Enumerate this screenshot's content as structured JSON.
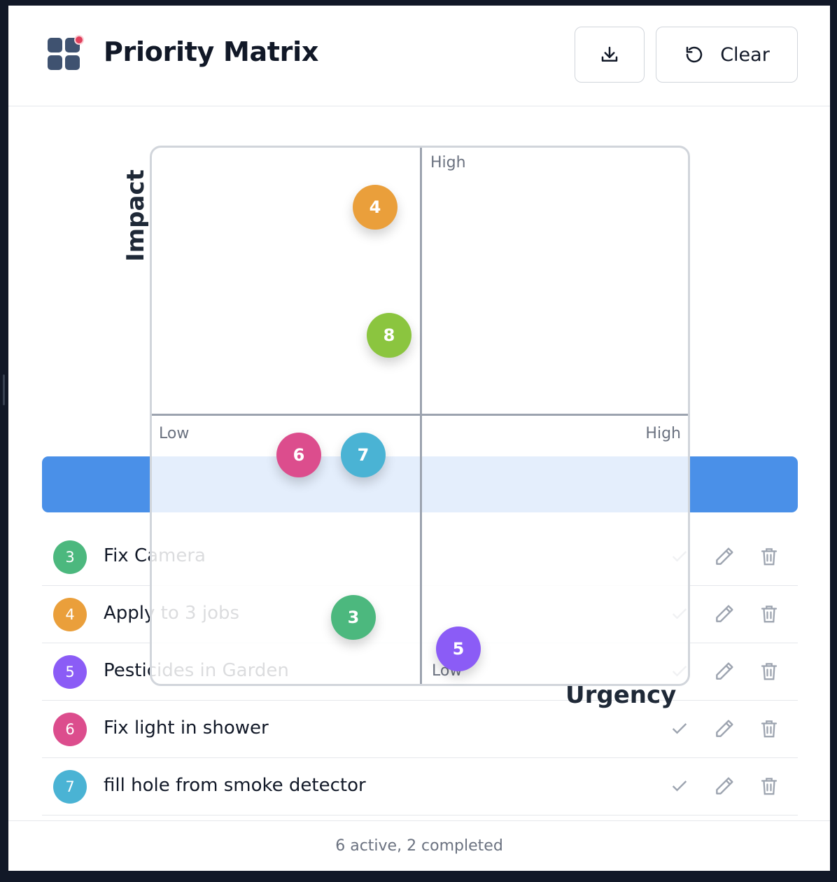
{
  "app": {
    "title": "Priority Matrix"
  },
  "toolbar": {
    "clear_label": "Clear"
  },
  "matrix": {
    "y_axis_label": "Impact",
    "x_axis_label": "Urgency",
    "quadrant_labels": {
      "high_top": "High",
      "low_left": "Low",
      "high_right": "High",
      "low_bottom": "Low"
    },
    "bubbles": [
      {
        "number": "4",
        "color": "#ea9f3b"
      },
      {
        "number": "8",
        "color": "#8bc53f"
      },
      {
        "number": "6",
        "color": "#dc4d8d"
      },
      {
        "number": "7",
        "color": "#4ab3d4"
      },
      {
        "number": "3",
        "color": "#4cb87e"
      },
      {
        "number": "5",
        "color": "#8b5cf6"
      }
    ]
  },
  "tasks": [
    {
      "number": "3",
      "label": "Fix Camera",
      "color": "#4cb87e"
    },
    {
      "number": "4",
      "label": "Apply to 3 jobs",
      "color": "#ea9f3b"
    },
    {
      "number": "5",
      "label": "Pesticides in Garden",
      "color": "#8b5cf6"
    },
    {
      "number": "6",
      "label": "Fix light in shower",
      "color": "#dc4d8d"
    },
    {
      "number": "7",
      "label": "fill hole from smoke detector",
      "color": "#4ab3d4"
    }
  ],
  "footer": {
    "status": "6 active, 2 completed"
  },
  "icons": {
    "download": "download-icon",
    "reset": "reset-icon",
    "check": "check-icon",
    "edit": "pencil-icon",
    "delete": "trash-icon"
  }
}
